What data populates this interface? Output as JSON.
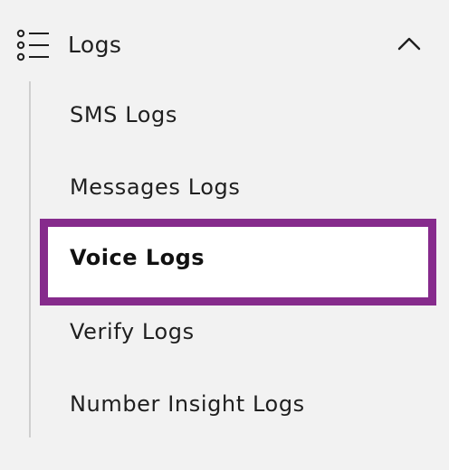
{
  "logs_group": {
    "icon": "list-icon",
    "label": "Logs",
    "expanded": true,
    "toggle_icon": "chevron-up-icon",
    "items": [
      {
        "label": "SMS Logs",
        "active": false
      },
      {
        "label": "Messages Logs",
        "active": false
      },
      {
        "label": "Voice Logs",
        "active": true
      },
      {
        "label": "Verify Logs",
        "active": false
      },
      {
        "label": "Number Insight Logs",
        "active": false
      }
    ]
  },
  "colors": {
    "background": "#f2f2f2",
    "active_background": "#ffffff",
    "active_border": "#862b8c",
    "text": "#1f1f1f",
    "tree_line": "#cfcfcf"
  }
}
